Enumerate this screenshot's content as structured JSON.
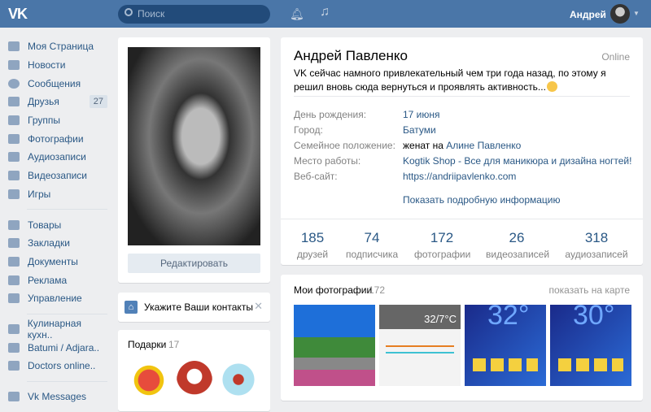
{
  "header": {
    "logo": "VK",
    "search_placeholder": "Поиск",
    "user_name": "Андрей"
  },
  "sidebar": {
    "items": [
      {
        "label": "Моя Страница"
      },
      {
        "label": "Новости"
      },
      {
        "label": "Сообщения"
      },
      {
        "label": "Друзья",
        "badge": "27"
      },
      {
        "label": "Группы"
      },
      {
        "label": "Фотографии"
      },
      {
        "label": "Аудиозаписи"
      },
      {
        "label": "Видеозаписи"
      },
      {
        "label": "Игры"
      },
      {
        "label": "Товары"
      },
      {
        "label": "Закладки"
      },
      {
        "label": "Документы"
      },
      {
        "label": "Реклама"
      },
      {
        "label": "Управление"
      },
      {
        "label": "Кулинарная кухн.."
      },
      {
        "label": "Batumi / Adjara.."
      },
      {
        "label": "Doctors online.."
      },
      {
        "label": "Vk Messages"
      }
    ]
  },
  "left": {
    "edit_label": "Редактировать",
    "contacts_label": "Укажите Ваши контакты",
    "gifts_title": "Подарки",
    "gifts_count": "17"
  },
  "profile": {
    "name": "Андрей Павленко",
    "online": "Online",
    "status": "VK сейчас намного привлекательный чем три года назад, по этому я решил вновь сюда вернуться и проявлять активность...",
    "rows": [
      {
        "label": "День рождения:",
        "value": "17 июня"
      },
      {
        "label": "Город:",
        "value": "Батуми"
      },
      {
        "label": "Семейное положение:",
        "prefix": "женат на",
        "value": "Алине Павленко"
      },
      {
        "label": "Место работы:",
        "value": "Kogtik Shop - Все для маникюра и дизайна ногтей!"
      },
      {
        "label": "Веб-сайт:",
        "value": "https://andriipavlenko.com"
      }
    ],
    "show_more": "Показать подробную информацию",
    "stats": [
      {
        "n": "185",
        "l": "друзей"
      },
      {
        "n": "74",
        "l": "подписчика"
      },
      {
        "n": "172",
        "l": "фотографии"
      },
      {
        "n": "26",
        "l": "видеозаписей"
      },
      {
        "n": "318",
        "l": "аудиозаписей"
      }
    ]
  },
  "photos": {
    "title": "Мои фотографии",
    "count": "172",
    "map_link": "показать на карте",
    "thumb_texts": [
      "32/7°C",
      "32°",
      "30°"
    ]
  }
}
